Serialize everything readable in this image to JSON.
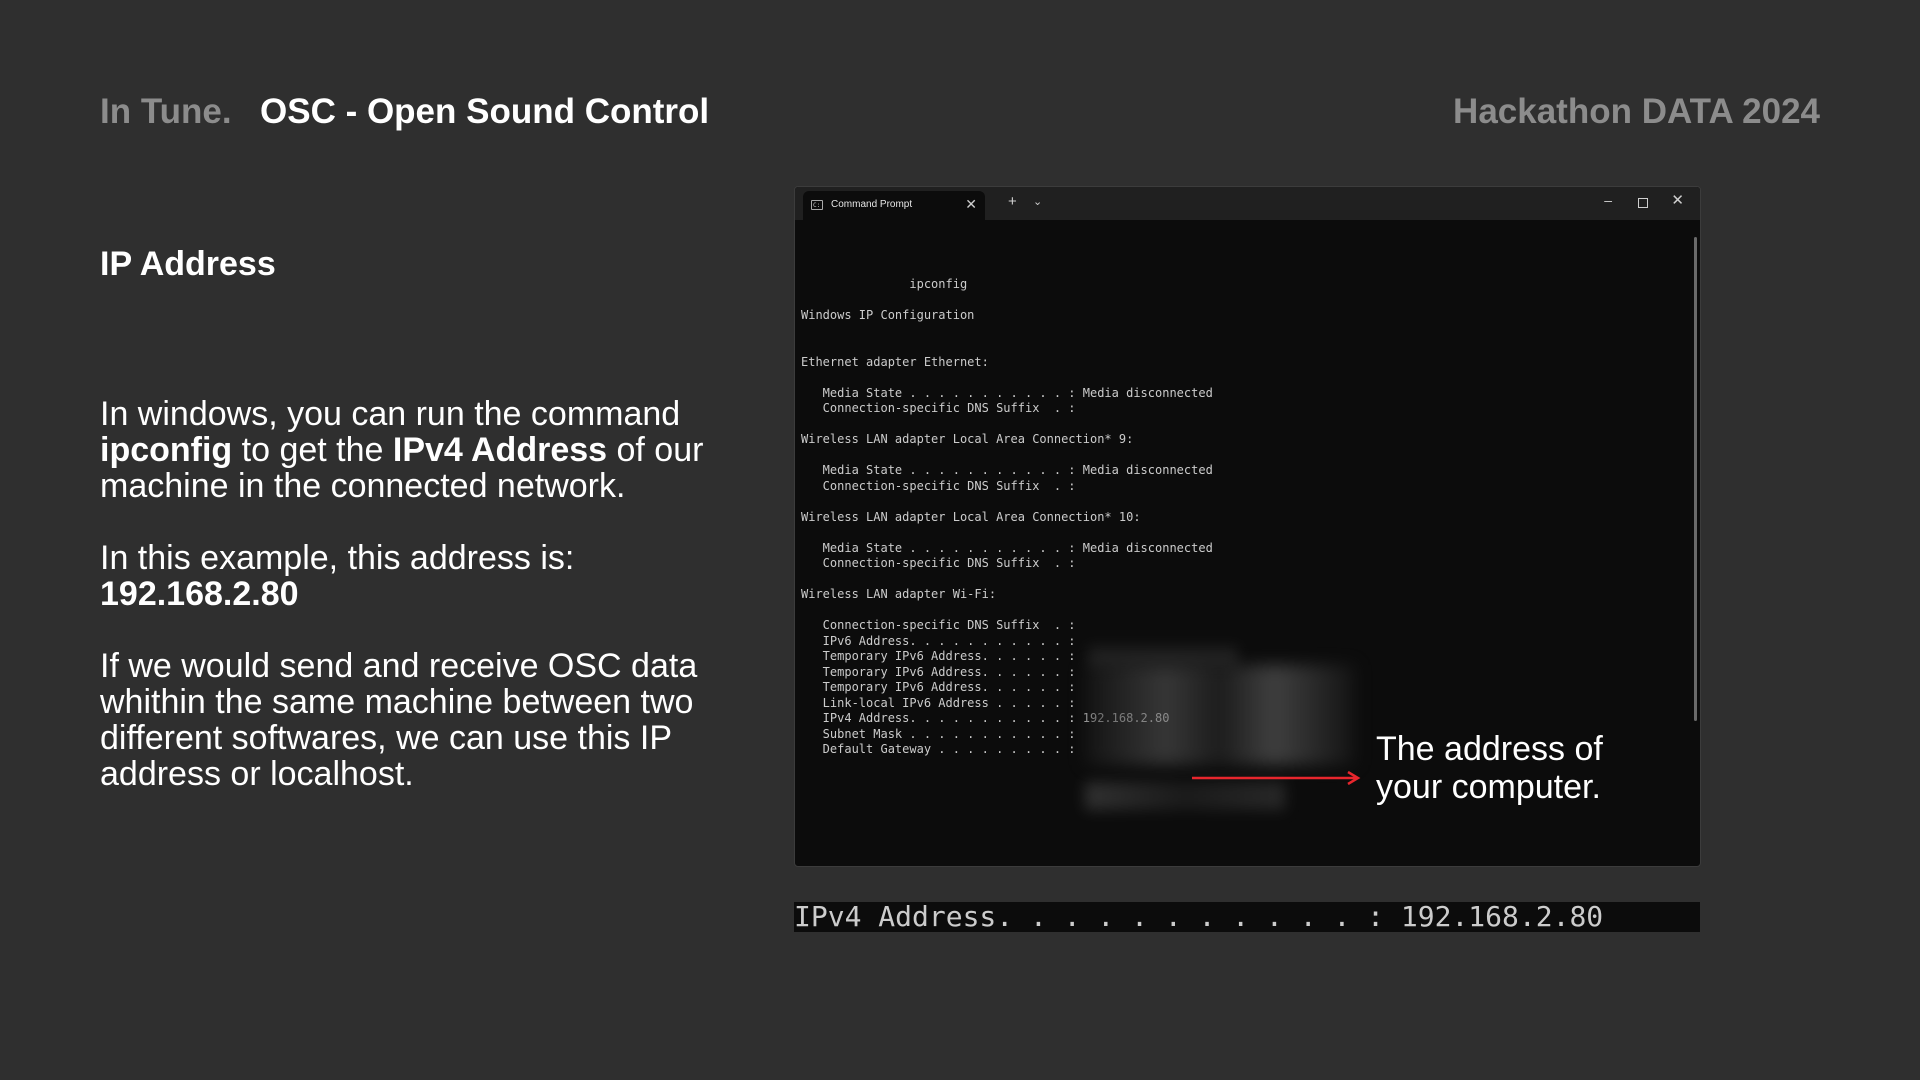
{
  "header": {
    "brand": "In Tune.",
    "title": "OSC - Open Sound Control",
    "event": "Hackathon DATA 2024"
  },
  "section": {
    "heading": "IP Address"
  },
  "body": {
    "p1_a": "In windows, you can run the command ",
    "p1_bold1": "ipconfig",
    "p1_b": " to get the ",
    "p1_bold2": "IPv4 Address",
    "p1_c": " of our machine in the connected network.",
    "p2_a": "In this example, this address is: ",
    "p2_bold": "192.168.2.80",
    "p3": "If we would send and receive OSC data whithin the same machine between two different softwares, we can use this IP address or localhost."
  },
  "terminal": {
    "tab_label": "Command Prompt",
    "tab_close": "✕",
    "tab_add": "+",
    "tab_dropdown": "⌄",
    "minimize": "–",
    "close": "✕",
    "output": "               ipconfig\n\nWindows IP Configuration\n\n\nEthernet adapter Ethernet:\n\n   Media State . . . . . . . . . . . : Media disconnected\n   Connection-specific DNS Suffix  . :\n\nWireless LAN adapter Local Area Connection* 9:\n\n   Media State . . . . . . . . . . . : Media disconnected\n   Connection-specific DNS Suffix  . :\n\nWireless LAN adapter Local Area Connection* 10:\n\n   Media State . . . . . . . . . . . : Media disconnected\n   Connection-specific DNS Suffix  . :\n\nWireless LAN adapter Wi-Fi:\n\n   Connection-specific DNS Suffix  . :\n   IPv6 Address. . . . . . . . . . . :\n   Temporary IPv6 Address. . . . . . :\n   Temporary IPv6 Address. . . . . . :\n   Temporary IPv6 Address. . . . . . :\n   Link-local IPv6 Address . . . . . :\n   IPv4 Address. . . . . . . . . . . : 192.168.2.80\n   Subnet Mask . . . . . . . . . . . :\n   Default Gateway . . . . . . . . . :"
  },
  "callout": {
    "text": "The address of your computer.",
    "arrow_color": "#e8262d"
  },
  "zoom": {
    "line": "IPv4 Address. . . . . . . . . . . : 192.168.2.80"
  },
  "colors": {
    "background": "#2f2f2f",
    "muted": "#8c8c8c",
    "terminal_bg": "#0c0c0c"
  }
}
